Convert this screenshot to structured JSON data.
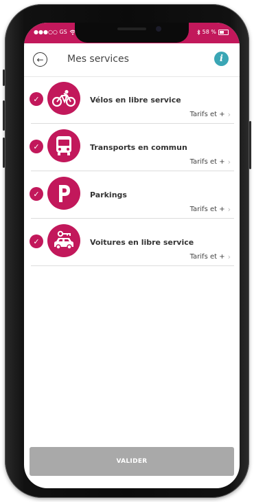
{
  "status_bar": {
    "carrier": "●●●○○ GS",
    "battery": "58 %"
  },
  "header": {
    "title": "Mes services",
    "info_glyph": "i"
  },
  "services": [
    {
      "label": "Vélos en libre service",
      "tarif": "Tarifs et +",
      "icon": "bike-icon",
      "checked": true
    },
    {
      "label": "Transports en commun",
      "tarif": "Tarifs et +",
      "icon": "bus-icon",
      "checked": true
    },
    {
      "label": "Parkings",
      "tarif": "Tarifs et +",
      "icon": "parking-icon",
      "checked": true
    },
    {
      "label": "Voitures en libre service",
      "tarif": "Tarifs et +",
      "icon": "car-icon",
      "checked": true
    }
  ],
  "footer": {
    "validate_label": "VALIDER"
  },
  "colors": {
    "accent": "#c2185b",
    "info": "#3aa6b5",
    "button_disabled": "#a9a9a9"
  }
}
